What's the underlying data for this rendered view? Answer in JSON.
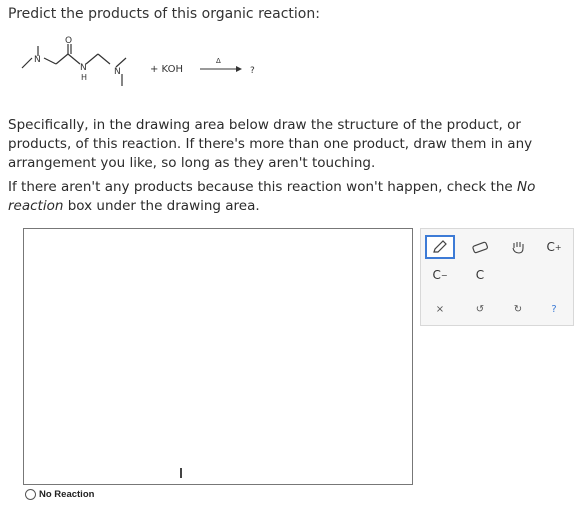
{
  "question": {
    "title": "Predict the products of this organic reaction:",
    "reagent": "+ KOH",
    "arrow_condition": "Δ",
    "product_placeholder": "?",
    "atoms": {
      "n1": "N",
      "o": "O",
      "n2": "N",
      "h": "H",
      "n3": "N"
    }
  },
  "instructions": {
    "paragraph1": "Specifically, in the drawing area below draw the structure of the product, or products, of this reaction. If there's more than one product, draw them in any arrangement you like, so long as they aren't touching.",
    "paragraph2_prefix": "If there aren't any products because this reaction won't happen, check the ",
    "paragraph2_emph": "No reaction",
    "paragraph2_suffix": " box under the drawing area."
  },
  "no_reaction_label": "No Reaction",
  "toolbar": {
    "tools": [
      {
        "name": "pencil-tool",
        "icon": "pencil-icon",
        "selected": true
      },
      {
        "name": "eraser-tool",
        "icon": "eraser-icon",
        "selected": false
      },
      {
        "name": "hand-tool",
        "icon": "hand-icon",
        "selected": false
      },
      {
        "name": "cation-tool",
        "label": "C",
        "charge": "+"
      },
      {
        "name": "anion-tool",
        "label": "C",
        "charge": "−"
      },
      {
        "name": "radical-tool",
        "label": "C",
        "dots": "¨"
      },
      {
        "name": "clear-tool",
        "label": "×"
      },
      {
        "name": "undo-tool",
        "label": "↺"
      },
      {
        "name": "redo-tool",
        "label": "↻"
      },
      {
        "name": "help-tool",
        "label": "?"
      }
    ]
  }
}
